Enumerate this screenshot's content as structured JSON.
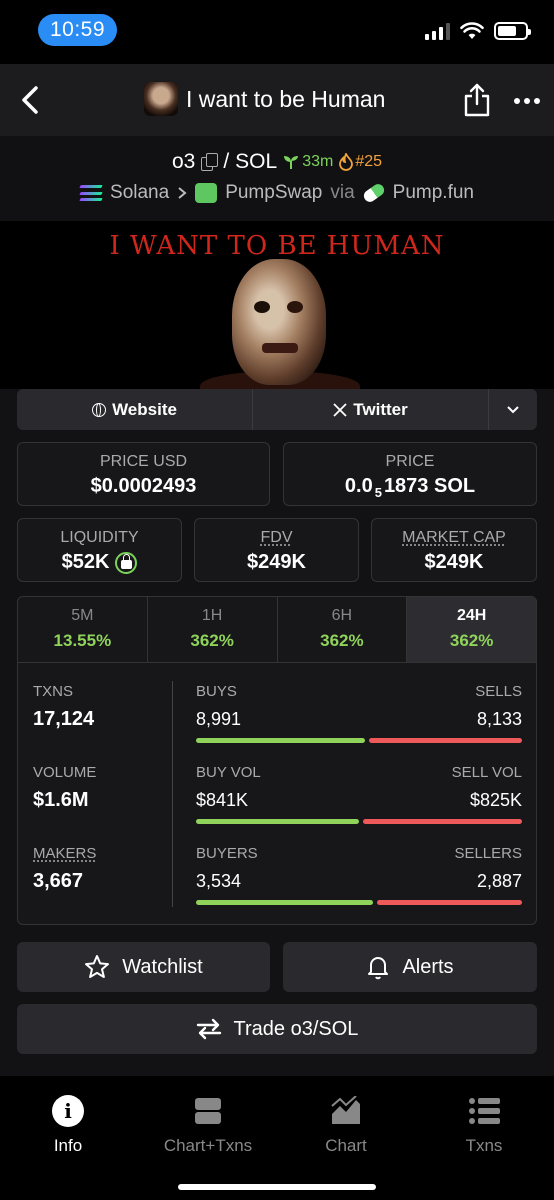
{
  "status_bar": {
    "time": "10:59"
  },
  "nav": {
    "title": "I want to be Human"
  },
  "pair": {
    "base": "o3",
    "quote": "SOL",
    "age": "33m",
    "rank": "#25",
    "chain": "Solana",
    "dex": "PumpSwap",
    "via_label": "via",
    "launchpad": "Pump.fun"
  },
  "banner": {
    "text": "I WANT TO BE HUMAN"
  },
  "links": {
    "website": "Website",
    "twitter": "Twitter"
  },
  "metrics": {
    "price_usd": {
      "label": "PRICE USD",
      "value": "$0.0002493"
    },
    "price": {
      "label": "PRICE",
      "value_prefix": "0.0",
      "value_sub": "5",
      "value_suffix": "1873 SOL"
    },
    "liquidity": {
      "label": "LIQUIDITY",
      "value": "$52K"
    },
    "fdv": {
      "label": "FDV",
      "value": "$249K"
    },
    "market_cap": {
      "label": "MARKET CAP",
      "value": "$249K"
    }
  },
  "timeframes": [
    {
      "label": "5M",
      "change": "13.55%"
    },
    {
      "label": "1H",
      "change": "362%"
    },
    {
      "label": "6H",
      "change": "362%"
    },
    {
      "label": "24H",
      "change": "362%"
    }
  ],
  "stats": {
    "txns": {
      "label": "TXNS",
      "value": "17,124",
      "buys_label": "BUYS",
      "buys": "8,991",
      "sells_label": "SELLS",
      "sells": "8,133",
      "buy_fraction": 0.525
    },
    "volume": {
      "label": "VOLUME",
      "value": "$1.6M",
      "buys_label": "BUY VOL",
      "buys": "$841K",
      "sells_label": "SELL VOL",
      "sells": "$825K",
      "buy_fraction": 0.505
    },
    "makers": {
      "label": "MAKERS",
      "value": "3,667",
      "buys_label": "BUYERS",
      "buys": "3,534",
      "sells_label": "SELLERS",
      "sells": "2,887",
      "buy_fraction": 0.55
    }
  },
  "actions": {
    "watchlist": "Watchlist",
    "alerts": "Alerts",
    "trade": "Trade o3/SOL"
  },
  "tabbar": [
    {
      "label": "Info",
      "icon": "info-icon"
    },
    {
      "label": "Chart+Txns",
      "icon": "chart-txns-icon"
    },
    {
      "label": "Chart",
      "icon": "chart-icon"
    },
    {
      "label": "Txns",
      "icon": "list-icon"
    }
  ],
  "colors": {
    "positive": "#8fd35a",
    "negative": "#ee5a5a",
    "time_pill": "#2a8cf5"
  }
}
